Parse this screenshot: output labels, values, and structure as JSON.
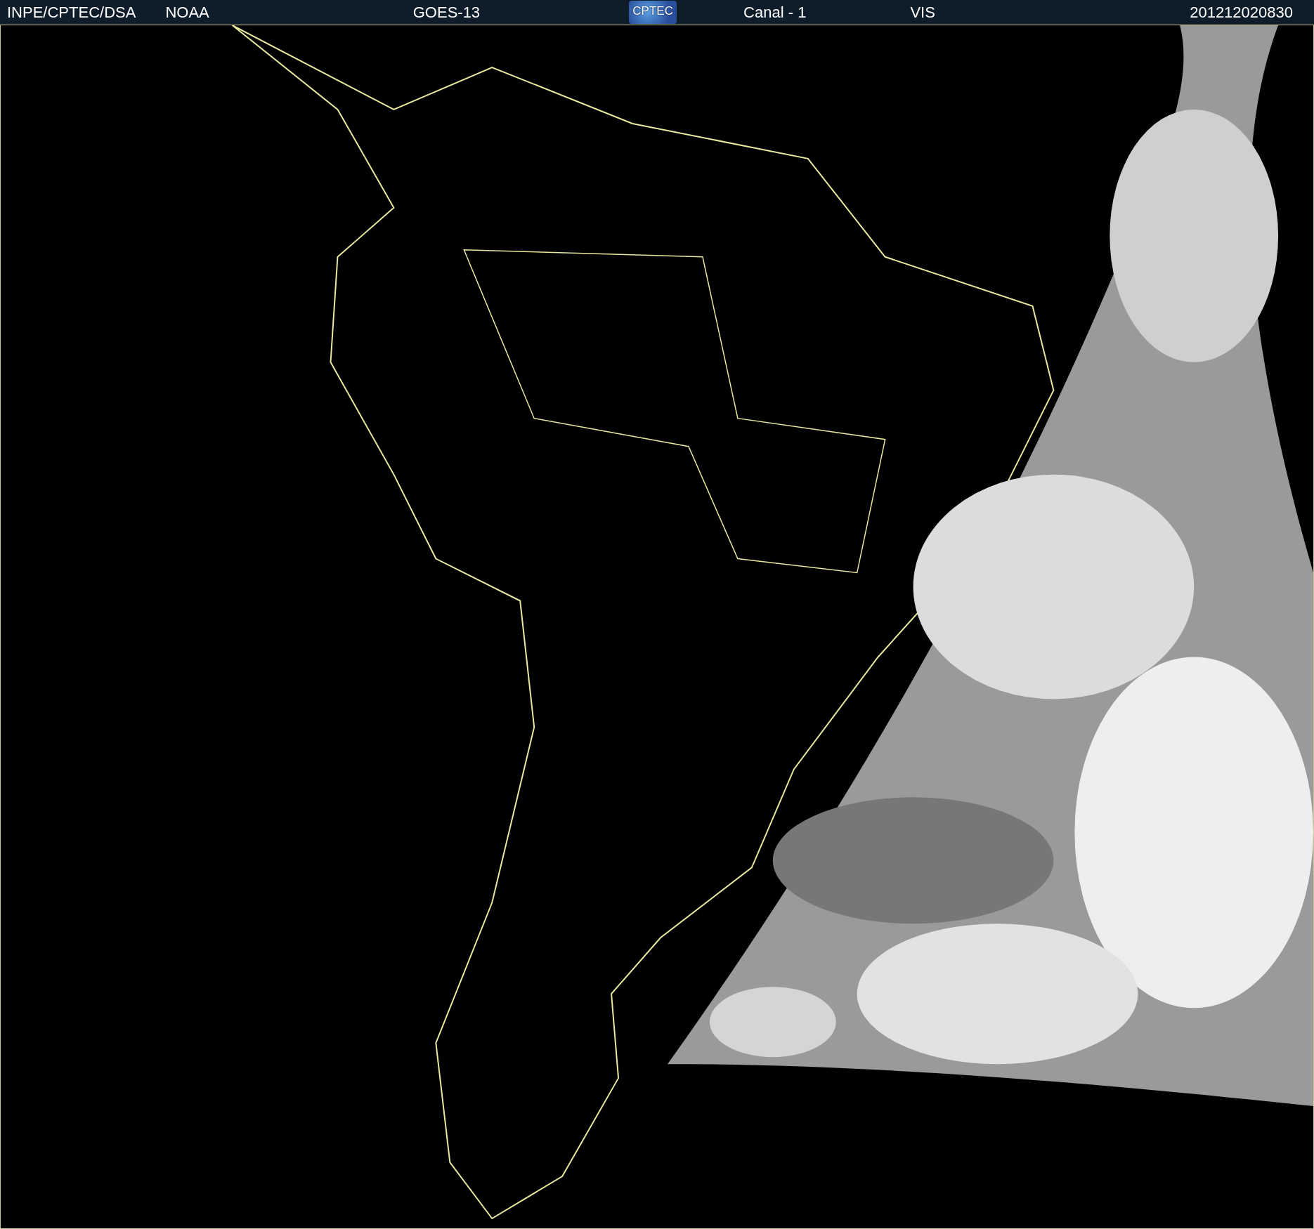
{
  "header": {
    "items": [
      {
        "kind": "text",
        "text": "INPE/CPTEC/DSA"
      },
      {
        "kind": "text",
        "text": "NOAA"
      },
      {
        "kind": "text",
        "text": "GOES-13"
      },
      {
        "kind": "logo",
        "text": "CPTEC"
      },
      {
        "kind": "text",
        "text": "Canal - 1"
      },
      {
        "kind": "text",
        "text": "VIS"
      },
      {
        "kind": "text",
        "text": "201212020830"
      }
    ]
  }
}
